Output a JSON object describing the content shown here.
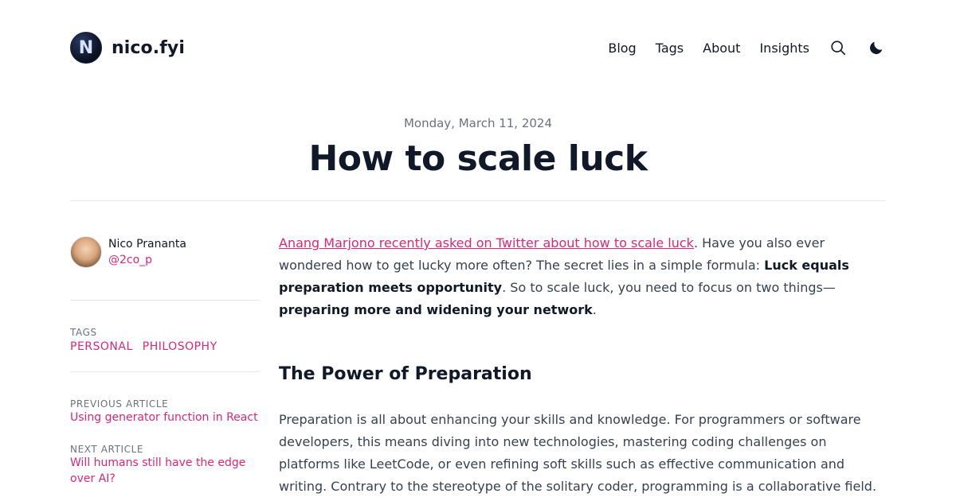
{
  "header": {
    "site_name": "nico.fyi",
    "logo_letter": "N",
    "nav": [
      "Blog",
      "Tags",
      "About",
      "Insights"
    ],
    "icons": [
      "search-icon",
      "moon-icon"
    ]
  },
  "post": {
    "date": "Monday, March 11, 2024",
    "title": "How to scale luck"
  },
  "sidebar": {
    "author_name": "Nico Prananta",
    "author_handle": "@2co_p",
    "tags_label": "Tags",
    "tags": [
      "personal",
      "philosophy"
    ],
    "previous_label": "Previous Article",
    "previous_title": "Using generator function in React",
    "next_label": "Next Article",
    "next_title": "Will humans still have the edge over AI?"
  },
  "article": {
    "intro_link": "Anang Marjono recently asked on Twitter about how to scale luck",
    "intro_1": ". Have you also ever wondered how to get lucky more often? The secret lies in a simple formula: ",
    "intro_bold_1": "Luck equals preparation meets opportunity",
    "intro_2": ". So to scale luck, you need to focus on two things—",
    "intro_bold_2": "preparing more and widening your network",
    "intro_3": ".",
    "heading": "The Power of Preparation",
    "paragraph": "Preparation is all about enhancing your skills and knowledge. For programmers or software developers, this means diving into new technologies, mastering coding challenges on platforms like LeetCode, or even refining soft skills such as effective communication and writing. Contrary to the stereotype of the solitary coder, programming is a collaborative field. It involves teamwork,"
  },
  "colors": {
    "accent": "#db2777",
    "text": "#111827",
    "muted": "#6b7280",
    "rule": "#e5e7eb"
  }
}
